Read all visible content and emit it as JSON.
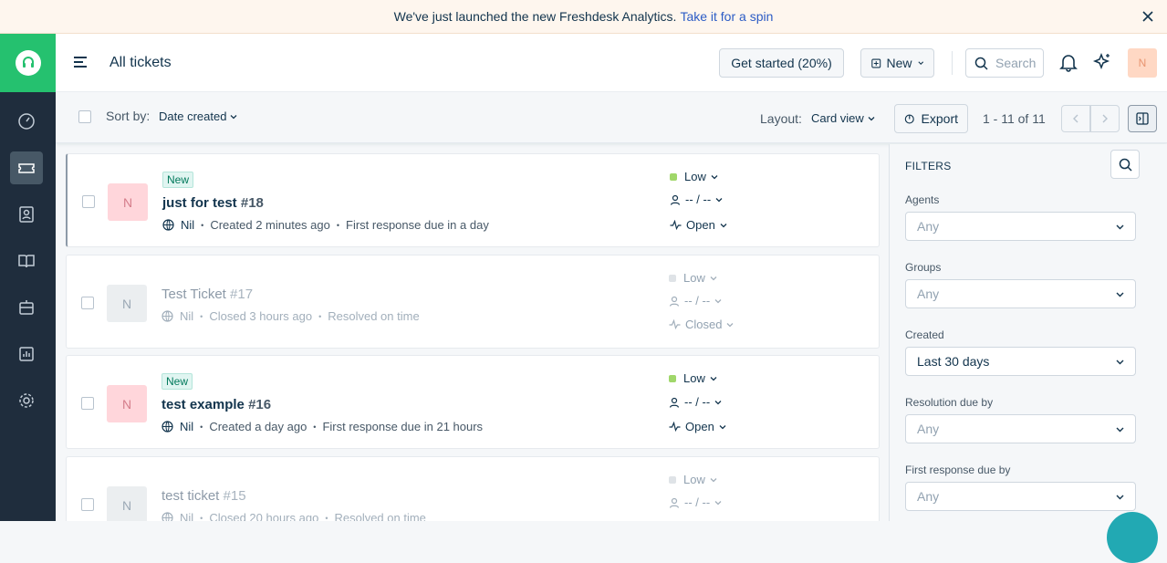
{
  "banner": {
    "text": "We've just launched the new Freshdesk Analytics.",
    "link": "Take it for a spin"
  },
  "header": {
    "title": "All tickets",
    "get_started": "Get started (20%)",
    "new_label": "New",
    "search_placeholder": "Search",
    "avatar_initial": "N"
  },
  "toolbar": {
    "sort_label": "Sort by:",
    "sort_value": "Date created",
    "layout_label": "Layout:",
    "layout_value": "Card view",
    "export_label": "Export",
    "pagination": "1 - 11 of 11"
  },
  "tickets": [
    {
      "initial": "N",
      "badge": "New",
      "subject": "just for test",
      "number": "#18",
      "requester": "Nil",
      "created": "Created 2 minutes ago",
      "sla": "First response due in a day",
      "priority": "Low",
      "assign": "-- / --",
      "status": "Open"
    },
    {
      "initial": "N",
      "badge": "",
      "subject": "Test Ticket",
      "number": "#17",
      "requester": "Nil",
      "created": "Closed 3 hours ago",
      "sla": "Resolved on time",
      "priority": "Low",
      "assign": "-- / --",
      "status": "Closed"
    },
    {
      "initial": "N",
      "badge": "New",
      "subject": "test example",
      "number": "#16",
      "requester": "Nil",
      "created": "Created a day ago",
      "sla": "First response due in 21 hours",
      "priority": "Low",
      "assign": "-- / --",
      "status": "Open"
    },
    {
      "initial": "N",
      "badge": "",
      "subject": "test ticket",
      "number": "#15",
      "requester": "Nil",
      "created": "Closed 20 hours ago",
      "sla": "Resolved on time",
      "priority": "Low",
      "assign": "-- / --",
      "status": ""
    }
  ],
  "filters": {
    "title": "FILTERS",
    "agents_label": "Agents",
    "agents_value": "Any",
    "groups_label": "Groups",
    "groups_value": "Any",
    "created_label": "Created",
    "created_value": "Last 30 days",
    "resolution_label": "Resolution due by",
    "resolution_value": "Any",
    "first_response_label": "First response due by",
    "first_response_value": "Any"
  },
  "colors": {
    "brand": "#25c16f",
    "sidebar": "#1f2d3d",
    "priority_low": "#a0d76a",
    "priority_low_muted": "#dfe3e7"
  },
  "icons": [
    "headset-icon",
    "dashboard-icon",
    "ticket-icon",
    "contacts-icon",
    "book-icon",
    "bot-icon",
    "reports-icon",
    "gear-icon",
    "bell-icon",
    "sparkle-icon",
    "search-icon",
    "globe-icon",
    "user-icon",
    "status-icon"
  ]
}
